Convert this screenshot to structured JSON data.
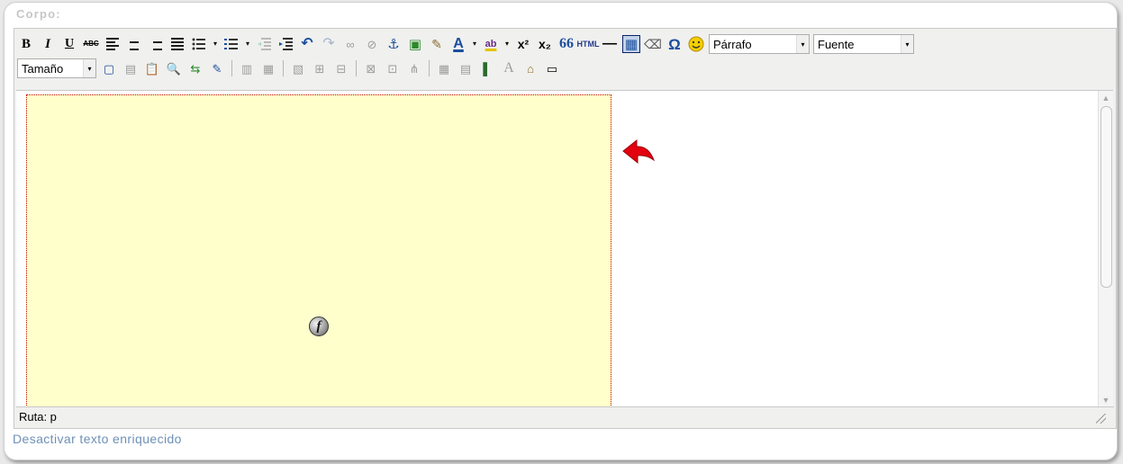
{
  "field": {
    "label": "Corpo:"
  },
  "toolbar": {
    "bold": "B",
    "italic": "I",
    "underline": "U",
    "strikethrough": "ABC",
    "undo": "↶",
    "redo": "↷",
    "link": "∞",
    "unlink": "⊘",
    "anchor": "⚓",
    "image": "▣",
    "cleanup": "✎",
    "forecolor": "A",
    "backcolor": "ab",
    "superscript": "x²",
    "subscript": "x₂",
    "blockquote": "66",
    "html": "HTML",
    "hr": "—",
    "table": "▦",
    "eraser": "⌫",
    "charmap": "Ω",
    "emotion": "☺",
    "format_select": "Párrafo",
    "font_select": "Fuente",
    "size_select": "Tamaño",
    "search": "🔍",
    "replace": "⇆",
    "row2_icons": [
      "▢",
      "▤",
      "📋",
      "✎",
      "▥",
      "▦",
      "▧",
      "⊞",
      "⊟",
      "⊠",
      "⊡",
      "⋔",
      "▦",
      "▤",
      "▌",
      "A",
      "⌂",
      "▭"
    ],
    "dropdown_arrow": "▾"
  },
  "editor": {
    "status_label": "Ruta: p",
    "scroll_up": "▲",
    "scroll_down": "▼",
    "flash_placeholder_glyph": "f"
  },
  "footer": {
    "toggle_label": "Desactivar texto enriquecido"
  },
  "colors": {
    "flash_bg": "#ffffcc",
    "flash_border": "#c00000",
    "arrow": "#e3000f",
    "link": "#6e90b8"
  }
}
